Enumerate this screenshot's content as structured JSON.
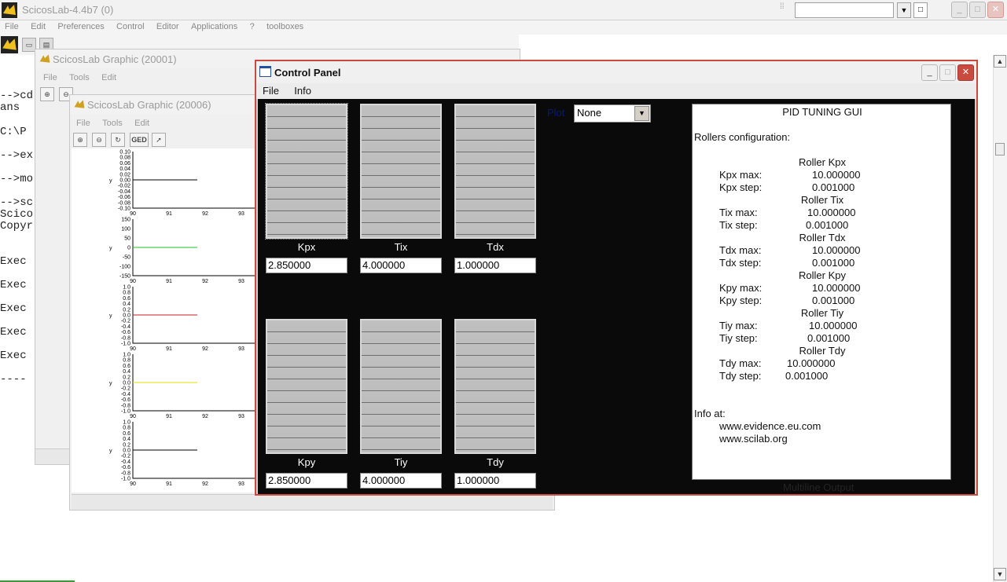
{
  "main_window": {
    "title": "ScicosLab-4.4b7 (0)",
    "menu": [
      "File",
      "Edit",
      "Preferences",
      "Control",
      "Editor",
      "Applications",
      "?",
      "toolboxes"
    ],
    "buttons": {
      "minimize": "_",
      "maximize": "□",
      "close": "✕"
    }
  },
  "console_lines": [
    "-->cd",
    " ans",
    " C:\\P",
    "-->ex",
    "-->mo",
    "-->sc",
    "Scico",
    "Copyr",
    " Exec",
    " Exec",
    " Exec",
    " Exec",
    " Exec",
    "----"
  ],
  "graphic_window_1": {
    "title": "ScicosLab Graphic (20001)",
    "menu": [
      "File",
      "Tools",
      "Edit"
    ]
  },
  "graphic_window_2": {
    "title": "ScicosLab Graphic (20006)",
    "menu": [
      "File",
      "Tools",
      "Edit"
    ],
    "toolbar": [
      "zoom-in",
      "zoom-out",
      "rotate",
      "GED",
      "pointer"
    ],
    "ged_label": "GED",
    "x_ticks": [
      "90",
      "91",
      "92",
      "93"
    ],
    "plots": [
      {
        "ylabels": [
          "0.10",
          "0.08",
          "0.06",
          "0.04",
          "0.02",
          "0.00",
          "-0.02",
          "-0.04",
          "-0.06",
          "-0.08",
          "-0.10"
        ],
        "ylabel": "y",
        "line_color": "#000000"
      },
      {
        "ylabels": [
          "150",
          "100",
          "50",
          "0",
          "-50",
          "-100",
          "-150"
        ],
        "ylabel": "y",
        "line_color": "#22c022"
      },
      {
        "ylabels": [
          "1.0",
          "0.8",
          "0.6",
          "0.4",
          "0.2",
          "0.0",
          "-0.2",
          "-0.4",
          "-0.6",
          "-0.8",
          "-1.0"
        ],
        "ylabel": "y",
        "line_color": "#c02020"
      },
      {
        "ylabels": [
          "1.0",
          "0.8",
          "0.6",
          "0.4",
          "0.2",
          "0.0",
          "-0.2",
          "-0.4",
          "-0.6",
          "-0.8",
          "-1.0"
        ],
        "ylabel": "y",
        "line_color": "#e0e000"
      },
      {
        "ylabels": [
          "1.0",
          "0.8",
          "0.6",
          "0.4",
          "0.2",
          "0.0",
          "-0.2",
          "-0.4",
          "-0.6",
          "-0.8",
          "-1.0"
        ],
        "ylabel": "y",
        "line_color": "#000000"
      }
    ]
  },
  "control_panel": {
    "title": "Control Panel",
    "menu": [
      "File",
      "Info"
    ],
    "rollers_top": [
      {
        "label": "Kpx",
        "value": "2.850000"
      },
      {
        "label": "Tix",
        "value": "4.000000"
      },
      {
        "label": "Tdx",
        "value": "1.000000"
      }
    ],
    "rollers_bottom": [
      {
        "label": "Kpy",
        "value": "2.850000"
      },
      {
        "label": "Tiy",
        "value": "4.000000"
      },
      {
        "label": "Tdy",
        "value": "1.000000"
      }
    ],
    "plot_label": "Plot",
    "plot_selected": "None",
    "info": {
      "title": "PID TUNING GUI",
      "config_header": "Rollers configuration:",
      "rollers": [
        {
          "name": "Roller Kpx",
          "max_label": "Kpx max:",
          "max": "10.000000",
          "step_label": "Kpx step:",
          "step": "0.001000"
        },
        {
          "name": "Roller Tix",
          "max_label": "Tix max:",
          "max": "10.000000",
          "step_label": "Tix step:",
          "step": "0.001000"
        },
        {
          "name": "Roller Tdx",
          "max_label": "Tdx max:",
          "max": "10.000000",
          "step_label": "Tdx step:",
          "step": "0.001000"
        },
        {
          "name": "Roller Kpy",
          "max_label": "Kpy max:",
          "max": "10.000000",
          "step_label": "Kpy step:",
          "step": "0.001000"
        },
        {
          "name": "Roller Tiy",
          "max_label": "Tiy max:",
          "max": "10.000000",
          "step_label": "Tiy step:",
          "step": "0.001000"
        },
        {
          "name": "Roller Tdy",
          "max_label": "Tdy max:",
          "max": "10.000000",
          "step_label": "Tdy step:",
          "step": "0.001000"
        }
      ],
      "info_at": "Info at:",
      "links": [
        "www.evidence.eu.com",
        "www.scilab.org"
      ]
    },
    "output_label": "Multiline Output"
  },
  "colors": {
    "panel_bg": "#0a0a0a",
    "active_border": "#c94a3e",
    "plot_label": "#0b1a6e"
  }
}
